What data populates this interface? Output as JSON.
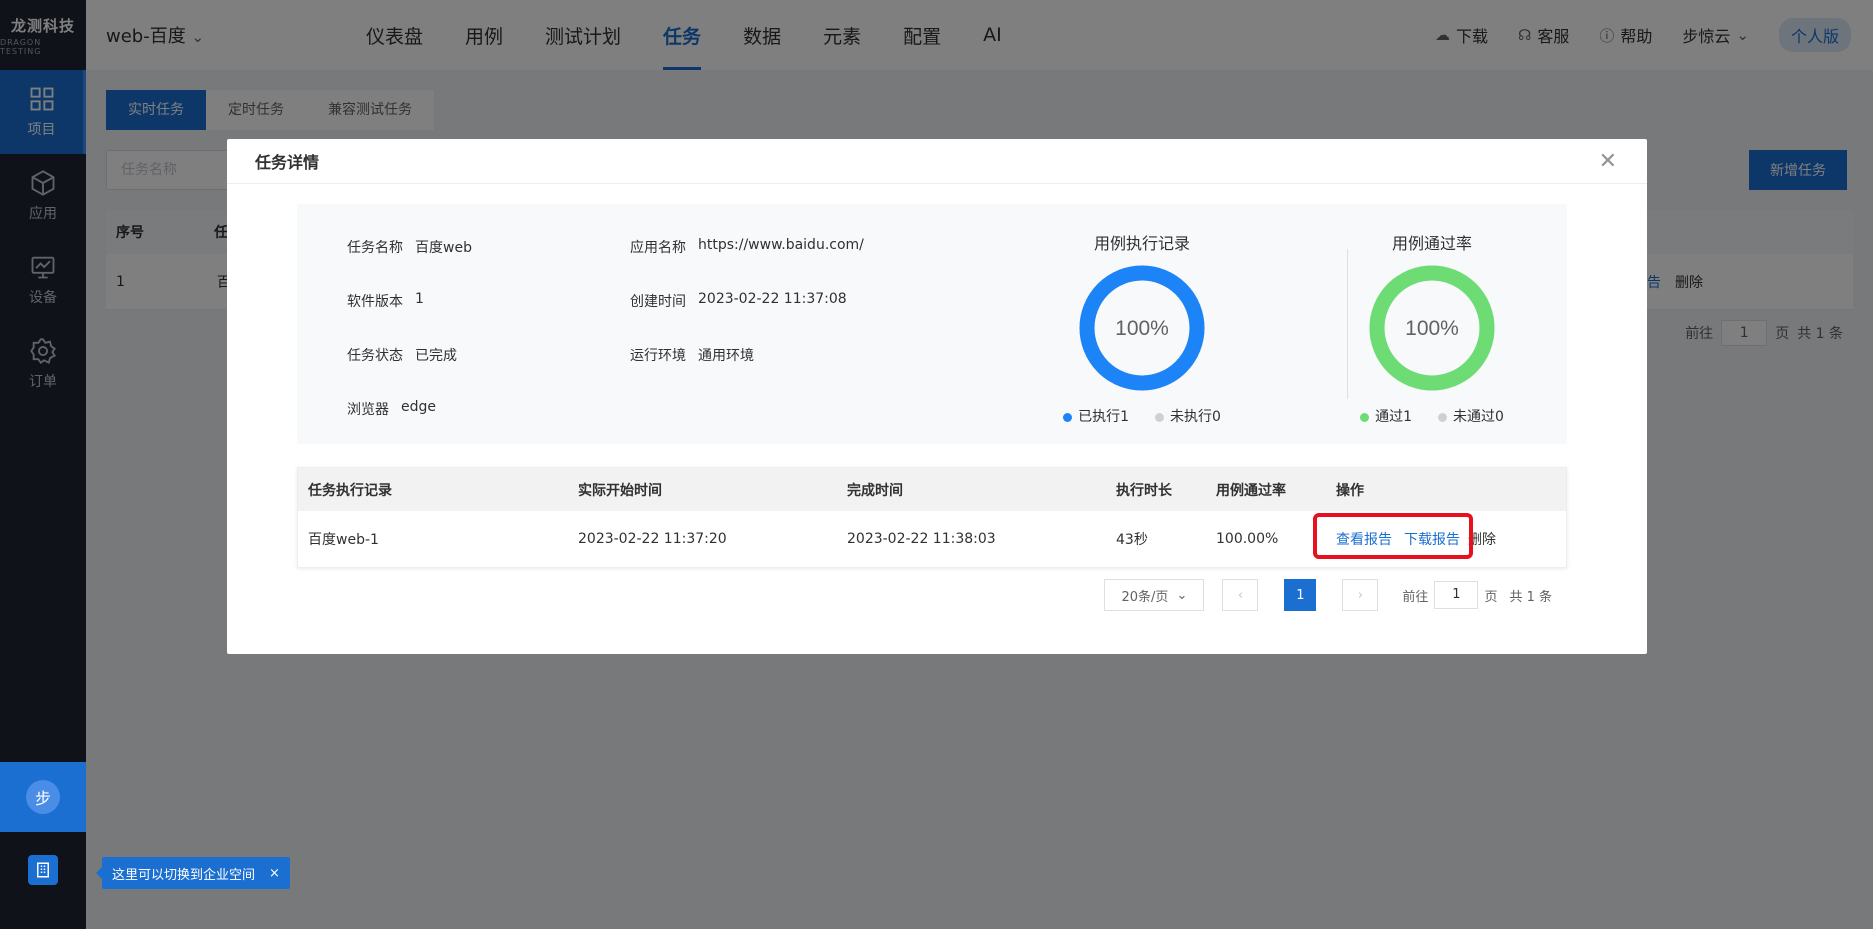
{
  "logo": {
    "line1": "龙测科技",
    "line2": "DRAGON TESTING"
  },
  "sidebar": {
    "items": [
      {
        "label": "项目",
        "icon": "grid-icon"
      },
      {
        "label": "应用",
        "icon": "cube-icon"
      },
      {
        "label": "设备",
        "icon": "monitor-icon"
      },
      {
        "label": "订单",
        "icon": "gear-icon"
      }
    ],
    "avatar": "步",
    "enterprise_icon": "building-icon"
  },
  "topnav": {
    "project": "web-百度",
    "menu": [
      "仪表盘",
      "用例",
      "测试计划",
      "任务",
      "数据",
      "元素",
      "配置",
      "AI"
    ],
    "active_menu": "任务",
    "right": {
      "download": "下载",
      "service": "客服",
      "help": "帮助",
      "user": "步惊云",
      "plan": "个人版"
    }
  },
  "page": {
    "tabs": [
      "实时任务",
      "定时任务",
      "兼容测试任务"
    ],
    "search_placeholder": "任务名称",
    "add_button": "新增任务",
    "table_head": [
      "序号",
      "任"
    ],
    "row": {
      "index": "1",
      "name": "百",
      "view": "查看报告",
      "delete": "删除"
    },
    "pager": {
      "goto": "前往",
      "page_num": "1",
      "page_unit": "页",
      "total": "共 1 条"
    }
  },
  "tip": {
    "text": "这里可以切换到企业空间"
  },
  "modal": {
    "title": "任务详情",
    "info": {
      "task_name_k": "任务名称",
      "task_name_v": "百度web",
      "version_k": "软件版本",
      "version_v": "1",
      "status_k": "任务状态",
      "status_v": "已完成",
      "browser_k": "浏览器",
      "browser_v": "edge",
      "app_k": "应用名称",
      "app_v": "https://www.baidu.com/",
      "created_k": "创建时间",
      "created_v": "2023-02-22 11:37:08",
      "env_k": "运行环境",
      "env_v": "通用环境"
    },
    "exec_chart": {
      "title": "用例执行记录",
      "center": "100%",
      "value": 1.0,
      "legend": [
        "已执行1",
        "未执行0"
      ],
      "color": "#1c84f6",
      "muted": "#d0d0d0"
    },
    "pass_chart": {
      "title": "用例通过率",
      "center": "100%",
      "value": 1.0,
      "legend": [
        "通过1",
        "未通过0"
      ],
      "color": "#6edc74",
      "muted": "#d0d0d0"
    },
    "table": {
      "headers": [
        "任务执行记录",
        "实际开始时间",
        "完成时间",
        "执行时长",
        "用例通过率",
        "操作"
      ],
      "rows": [
        {
          "record": "百度web-1",
          "start": "2023-02-22 11:37:20",
          "end": "2023-02-22 11:38:03",
          "duration": "43秒",
          "rate": "100.00%",
          "view": "查看报告",
          "download": "下载报告",
          "delete": "删除"
        }
      ]
    },
    "pager": {
      "size": "20条/页",
      "current": "1",
      "goto": "前往",
      "goto_value": "1",
      "page_unit": "页",
      "total": "共 1 条"
    }
  }
}
